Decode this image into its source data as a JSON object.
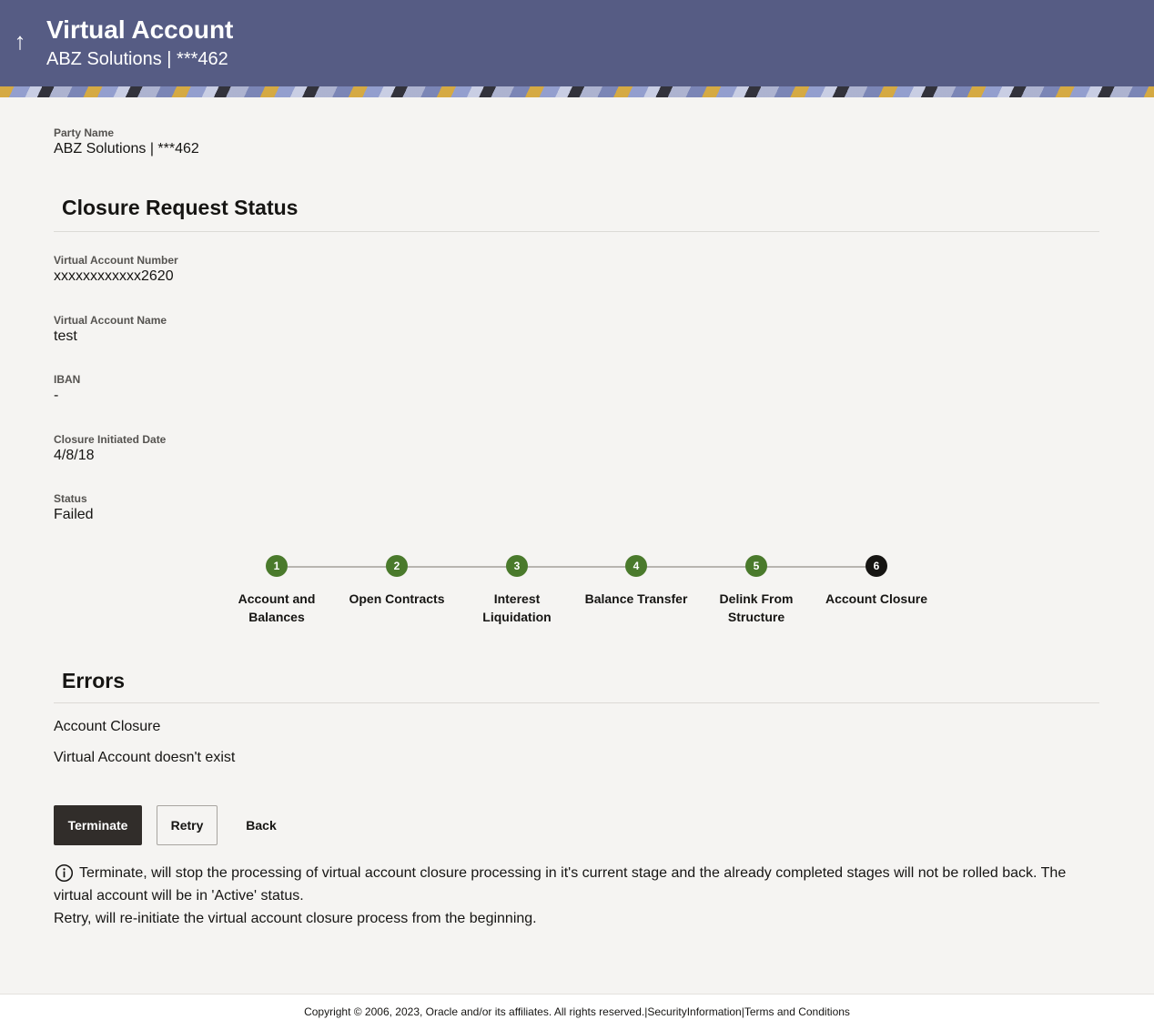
{
  "header": {
    "title": "Virtual Account",
    "subtitle": "ABZ Solutions | ***462"
  },
  "party": {
    "label": "Party Name",
    "value": "ABZ Solutions | ***462"
  },
  "closure_status": {
    "title": "Closure Request Status",
    "fields": [
      {
        "label": "Virtual Account Number",
        "value": "xxxxxxxxxxxx2620"
      },
      {
        "label": "Virtual Account Name",
        "value": "test"
      },
      {
        "label": "IBAN",
        "value": "-"
      },
      {
        "label": "Closure Initiated Date",
        "value": "4/8/18"
      },
      {
        "label": "Status",
        "value": "Failed"
      }
    ]
  },
  "stepper": {
    "steps": [
      {
        "number": "1",
        "line1": "Account and",
        "line2": "Balances",
        "state": "done"
      },
      {
        "number": "2",
        "line1": "Open Contracts",
        "line2": "",
        "state": "done"
      },
      {
        "number": "3",
        "line1": "Interest",
        "line2": "Liquidation",
        "state": "done"
      },
      {
        "number": "4",
        "line1": "Balance Transfer",
        "line2": "",
        "state": "done"
      },
      {
        "number": "5",
        "line1": "Delink From",
        "line2": "Structure",
        "state": "done"
      },
      {
        "number": "6",
        "line1": "Account Closure",
        "line2": "",
        "state": "current"
      }
    ],
    "colors": {
      "done": "#4a7a2c",
      "current": "#161513"
    }
  },
  "errors": {
    "title": "Errors",
    "stage": "Account Closure",
    "message": "Virtual Account doesn't exist"
  },
  "actions": {
    "terminate_label": "Terminate",
    "retry_label": "Retry",
    "back_label": "Back"
  },
  "note": {
    "icon": "info-icon",
    "line1": "Terminate, will stop the processing of virtual account closure processing in it's current stage and the already completed stages will not be rolled back. The virtual account will be in 'Active' status.",
    "line2": "Retry, will re-initiate the virtual account closure process from the beginning."
  },
  "footer": {
    "copyright": "Copyright © 2006, 2023, Oracle and/or its affiliates. All rights reserved.",
    "separator": "|",
    "security_link": "SecurityInformation",
    "terms_link": "Terms and Conditions"
  }
}
